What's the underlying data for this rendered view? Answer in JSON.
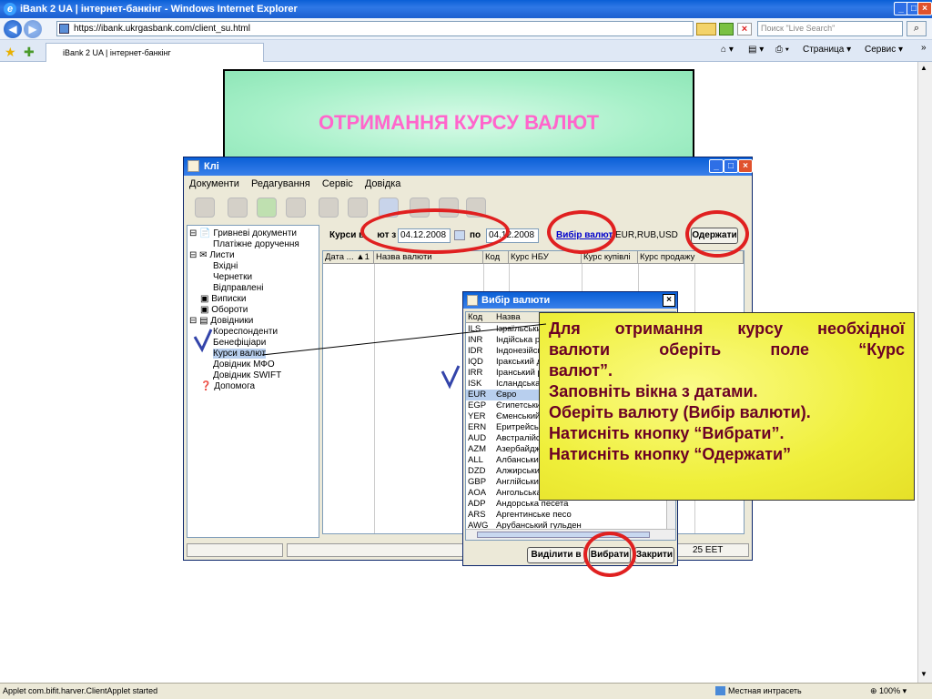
{
  "browser": {
    "title": "iBank 2 UA  |  інтернет-банкінг - Windows Internet Explorer",
    "url": "https://ibank.ukrgasbank.com/client_su.html",
    "search_placeholder": "Поиск \"Live Search\"",
    "tab_label": "iBank 2 UA | інтернет-банкінг",
    "cmd_page": "Страница",
    "cmd_service": "Сервис",
    "status_text": "Applet com.bifit.harver.ClientApplet started",
    "zone": "Местная интрасеть",
    "zoom": "100%"
  },
  "banner": {
    "title": "ОТРИМАННЯ КУРСУ ВАЛЮТ"
  },
  "app": {
    "title": "Клі",
    "menu": [
      "Документи",
      "Редагування",
      "Сервіс",
      "Довідка"
    ],
    "tree": [
      {
        "label": "Гривневі документи",
        "level": 0
      },
      {
        "label": "Платіжне доручення",
        "level": 1
      },
      {
        "label": "Листи",
        "level": 0
      },
      {
        "label": "Вхідні",
        "level": 1
      },
      {
        "label": "Чернетки",
        "level": 1
      },
      {
        "label": "Відправлені",
        "level": 1
      },
      {
        "label": "Виписки",
        "level": 0
      },
      {
        "label": "Обороти",
        "level": 0
      },
      {
        "label": "Довідники",
        "level": 0
      },
      {
        "label": "Кореспонденти",
        "level": 1
      },
      {
        "label": "Бенефіціари",
        "level": 1
      },
      {
        "label": "Курси валют",
        "level": 1
      },
      {
        "label": "Довідник МФО",
        "level": 1
      },
      {
        "label": "Довідник SWIFT",
        "level": 1
      },
      {
        "label": "Допомога",
        "level": 0
      }
    ],
    "rates_label_a": "Курси в",
    "rates_label_b": "ют з",
    "date_from": "04.12.2008",
    "to_label": "по",
    "date_to": "04.12.2008",
    "choose_currency": "Вибір валют",
    "currencies": "EUR,RUB,USD",
    "get_button": "Одержати",
    "columns": [
      "Дата ...",
      "Назва валюти",
      "Код",
      "Курс НБУ",
      "Курс купівлі",
      "Курс продажу"
    ],
    "status_time": "25 EET"
  },
  "dialog": {
    "title": "Вибір валюти",
    "col_code": "Код",
    "col_name": "Назва",
    "rows": [
      {
        "code": "ILS",
        "name": "Ізраїльський новий шекель"
      },
      {
        "code": "INR",
        "name": "Індійська рупія"
      },
      {
        "code": "IDR",
        "name": "Індонезійська рупія"
      },
      {
        "code": "IQD",
        "name": "Іракський динар"
      },
      {
        "code": "IRR",
        "name": "Іранський ріал"
      },
      {
        "code": "ISK",
        "name": "Ісландська крона"
      },
      {
        "code": "EUR",
        "name": "Євро"
      },
      {
        "code": "EGP",
        "name": "Єгипетський фунт"
      },
      {
        "code": "YER",
        "name": "Єменський ріал"
      },
      {
        "code": "ERN",
        "name": "Еритрейська накфа"
      },
      {
        "code": "AUD",
        "name": "Австралійський долар"
      },
      {
        "code": "AZM",
        "name": "Азербайджанський манат"
      },
      {
        "code": "ALL",
        "name": "Албанський лек"
      },
      {
        "code": "DZD",
        "name": "Алжирський динар"
      },
      {
        "code": "GBP",
        "name": "Англійський фунт"
      },
      {
        "code": "AOA",
        "name": "Ангольська кванза"
      },
      {
        "code": "ADP",
        "name": "Андорська песета"
      },
      {
        "code": "ARS",
        "name": "Аргентинське песо"
      },
      {
        "code": "AWG",
        "name": "Арубанський гульден"
      }
    ],
    "btn_select_all": "Виділити в",
    "btn_choose": "Вибрати",
    "btn_close": "Закрити"
  },
  "callout": {
    "line1": "Для отримання курсу необхідної",
    "line2": "валюти оберіть поле “Курс",
    "line3": "валют”.",
    "line4": "Заповніть вікна з датами.",
    "line5": "Оберіть валюту (Вибір валюти).",
    "line6": "Натисніть кнопку “Вибрати”.",
    "line7": "Натисніть кнопку “Одержати”"
  },
  "colors": {
    "accent_red": "#e02020",
    "banner_text": "#ff66cc",
    "callout_text": "#6b0025"
  }
}
